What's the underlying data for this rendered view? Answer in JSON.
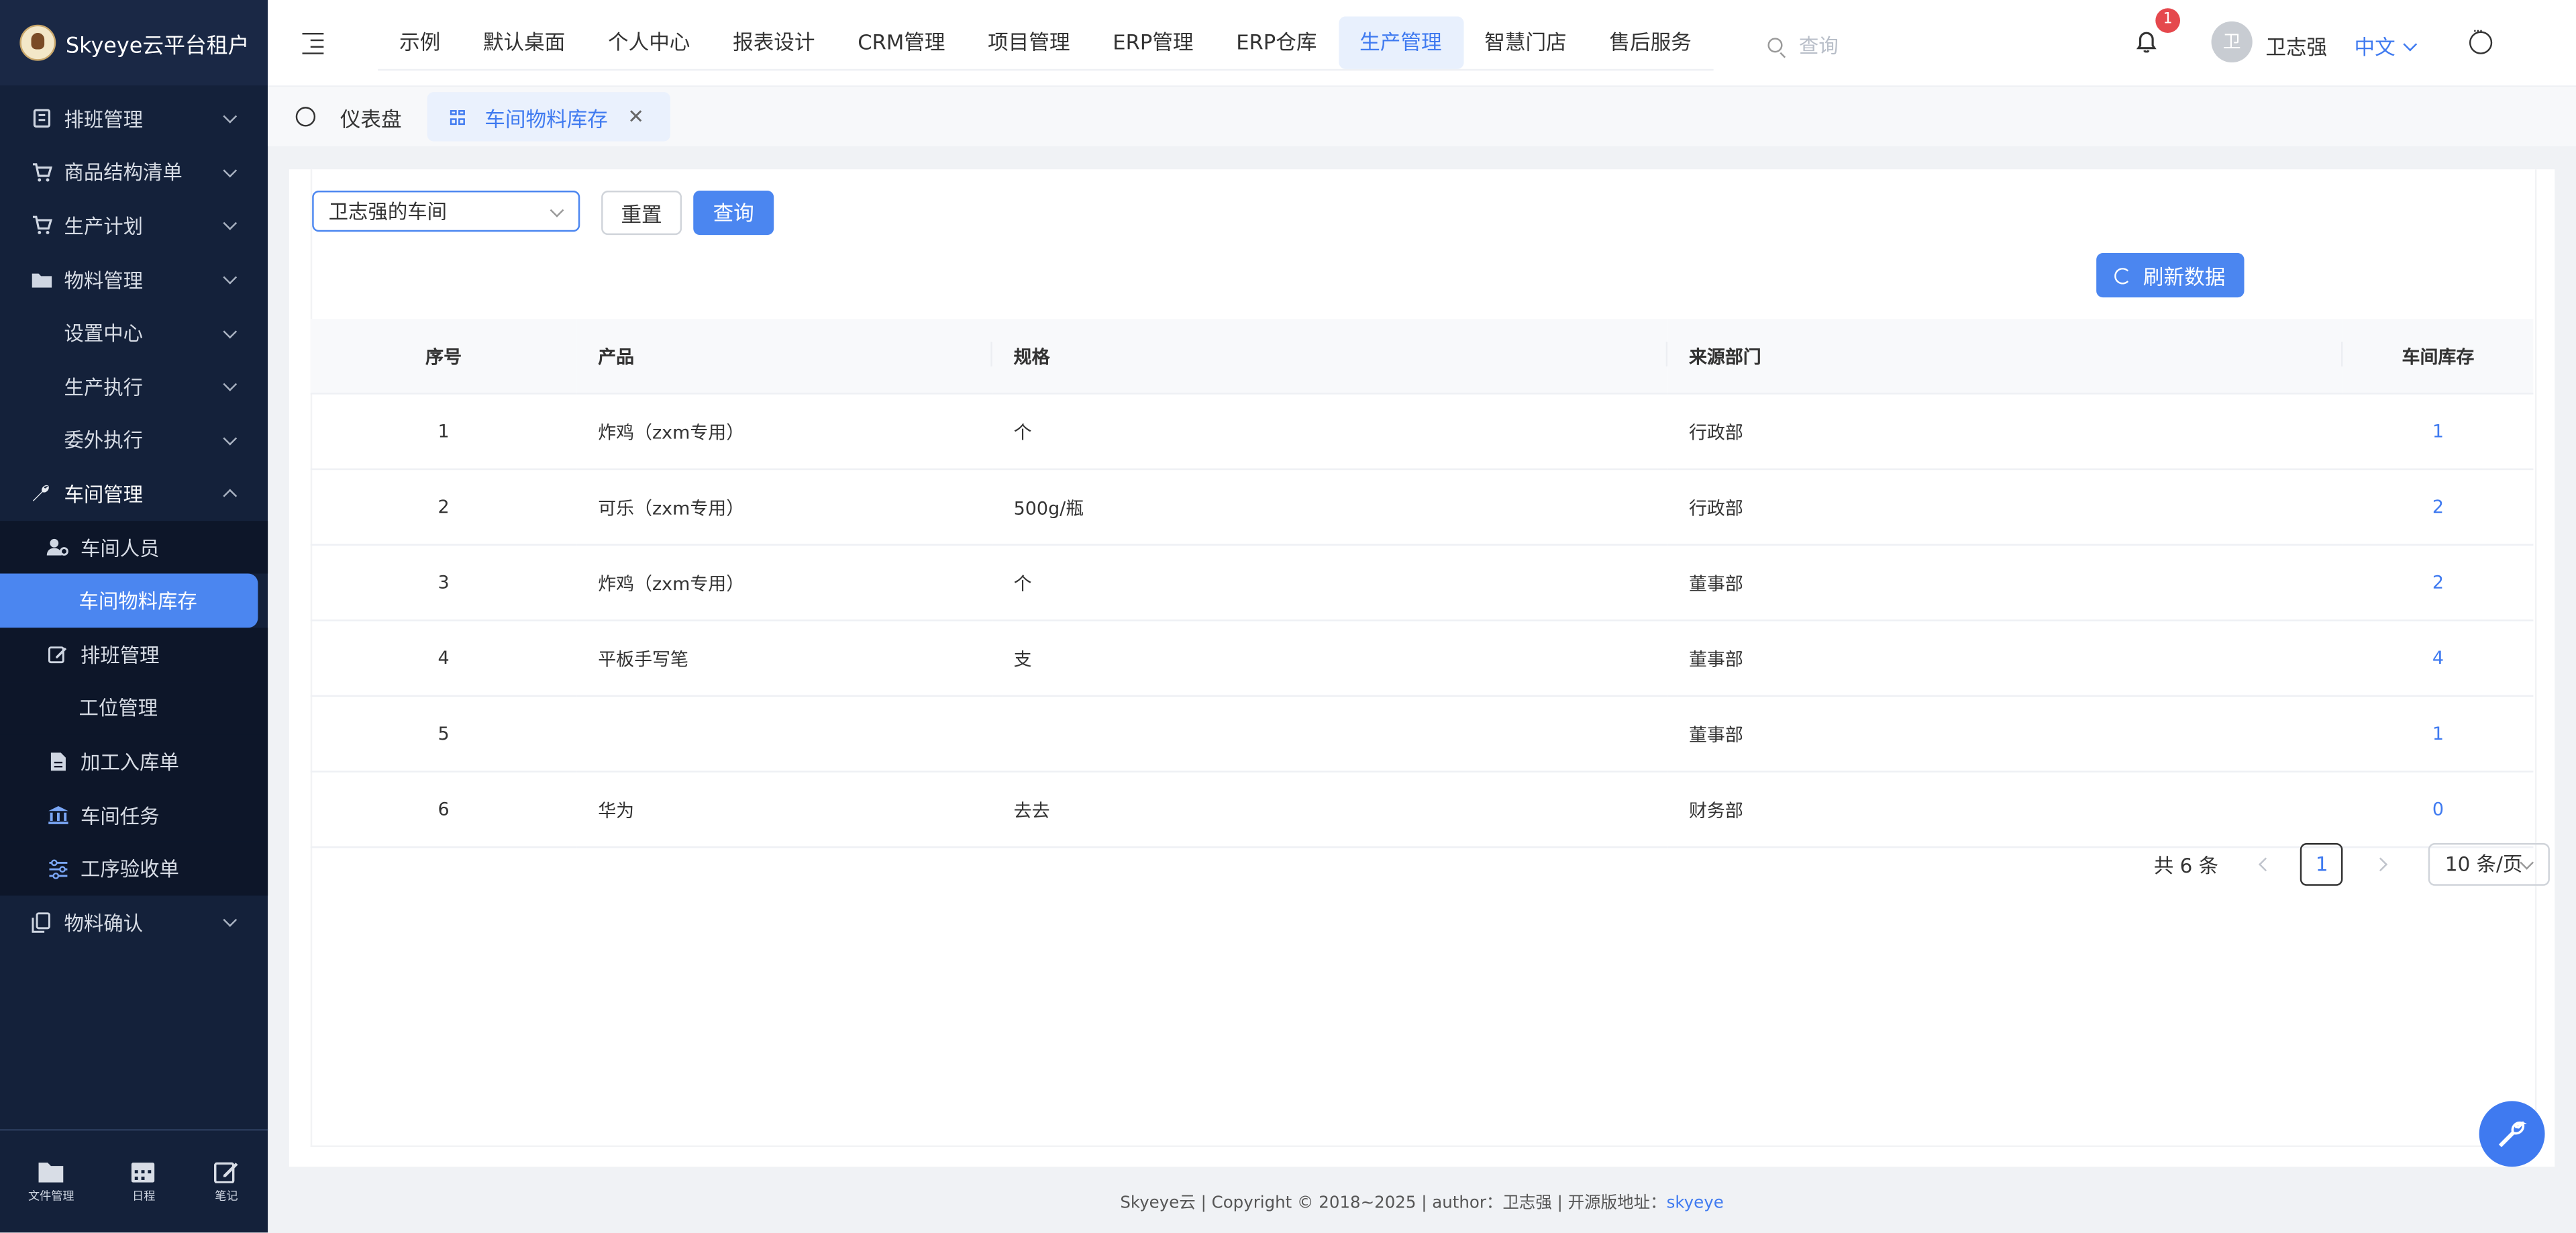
{
  "app": {
    "title": "Skyeye云平台租户"
  },
  "sidebar": {
    "items": [
      {
        "label": "排班管理",
        "icon": "calendar-icon"
      },
      {
        "label": "商品结构清单",
        "icon": "cart-icon"
      },
      {
        "label": "生产计划",
        "icon": "cart-icon"
      },
      {
        "label": "物料管理",
        "icon": "folder-icon"
      },
      {
        "label": "设置中心"
      },
      {
        "label": "生产执行"
      },
      {
        "label": "委外执行"
      },
      {
        "label": "车间管理",
        "icon": "wrench-icon"
      },
      {
        "label": "车间人员",
        "icon": "user-settings-icon"
      },
      {
        "label": "车间物料库存"
      },
      {
        "label": "排班管理",
        "icon": "edit-icon"
      },
      {
        "label": "工位管理"
      },
      {
        "label": "加工入库单",
        "icon": "document-icon"
      },
      {
        "label": "车间任务",
        "icon": "bank-icon"
      },
      {
        "label": "工序验收单",
        "icon": "sliders-icon"
      },
      {
        "label": "物料确认",
        "icon": "copy-icon"
      }
    ],
    "bottom": [
      {
        "label": "文件管理",
        "icon": "folder-icon"
      },
      {
        "label": "日程",
        "icon": "calendar-icon"
      },
      {
        "label": "笔记",
        "icon": "edit-icon"
      }
    ]
  },
  "header": {
    "nav": [
      "示例",
      "默认桌面",
      "个人中心",
      "报表设计",
      "CRM管理",
      "项目管理",
      "ERP管理",
      "ERP仓库",
      "生产管理",
      "智慧门店",
      "售后服务"
    ],
    "active_nav": "生产管理",
    "search_placeholder": "查询",
    "notification_count": "1",
    "avatar_initial": "卫",
    "user_name": "卫志强",
    "language": "中文"
  },
  "tabs": {
    "dashboard": "仪表盘",
    "current": "车间物料库存"
  },
  "filter": {
    "workshop": "卫志强的车间",
    "reset_label": "重置",
    "query_label": "查询",
    "refresh_label": "刷新数据"
  },
  "table": {
    "columns": [
      "序号",
      "产品",
      "规格",
      "来源部门",
      "车间库存"
    ],
    "rows": [
      [
        "1",
        "炸鸡（zxm专用）",
        "个",
        "行政部",
        "1"
      ],
      [
        "2",
        "可乐（zxm专用）",
        "500g/瓶",
        "行政部",
        "2"
      ],
      [
        "3",
        "炸鸡（zxm专用）",
        "个",
        "董事部",
        "2"
      ],
      [
        "4",
        "平板手写笔",
        "支",
        "董事部",
        "4"
      ],
      [
        "5",
        "",
        "",
        "董事部",
        "1"
      ],
      [
        "6",
        "华为",
        "去去",
        "财务部",
        "0"
      ]
    ]
  },
  "pagination": {
    "total": "共 6 条",
    "page": "1",
    "page_size": "10 条/页"
  },
  "footer": {
    "text": "Skyeye云 | Copyright © 2018~2025 | author：卫志强 | 开源版地址：",
    "link": "skyeye"
  },
  "colors": {
    "accent": "#4b86f0",
    "sidebar": "#14213a"
  }
}
